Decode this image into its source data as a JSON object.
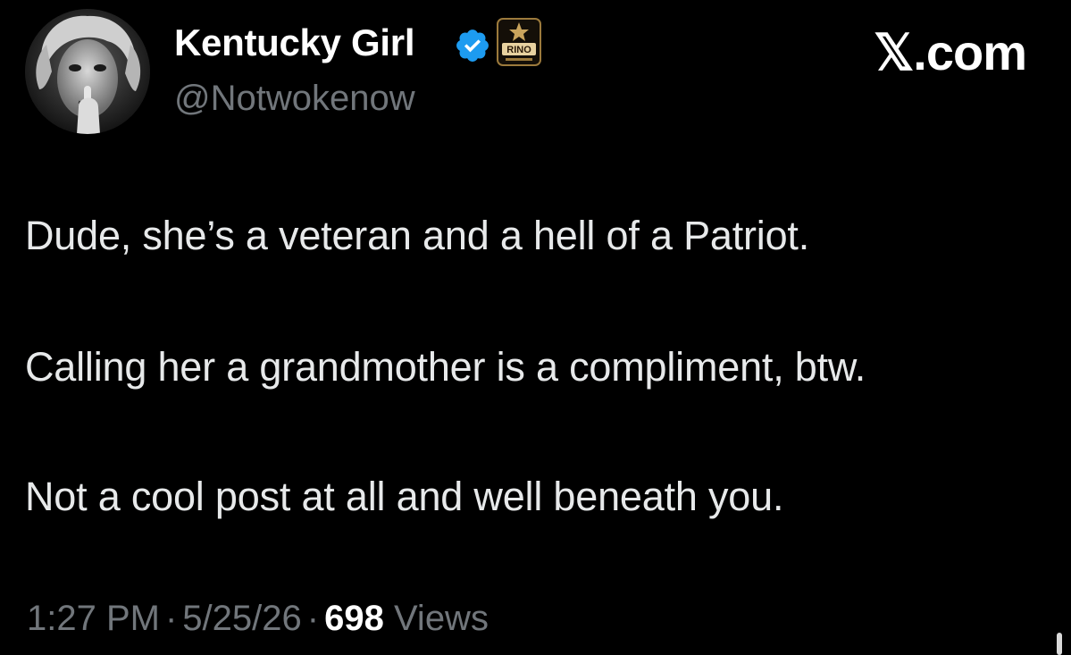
{
  "author": {
    "display_name": "Kentucky Girl",
    "handle": "@Notwokenow",
    "avatar_icon": "profile-photo",
    "verified_icon": "verified-checkmark-icon",
    "verified_color": "#1d9bf0",
    "badge_text": "RINO"
  },
  "source": {
    "label": "𝕏.com"
  },
  "body": {
    "lines": [
      "Dude, she’s a veteran and a hell of a Patriot.",
      "Calling her a grandmother is a compliment, btw.",
      "Not a cool post at all and well beneath you."
    ]
  },
  "meta": {
    "time": "1:27 PM",
    "separator": "·",
    "date": "5/25/26",
    "views_count": "698",
    "views_label": "Views"
  },
  "colors": {
    "background": "#000000",
    "primary_text": "#e7e9ea",
    "secondary_text": "#71767b"
  }
}
